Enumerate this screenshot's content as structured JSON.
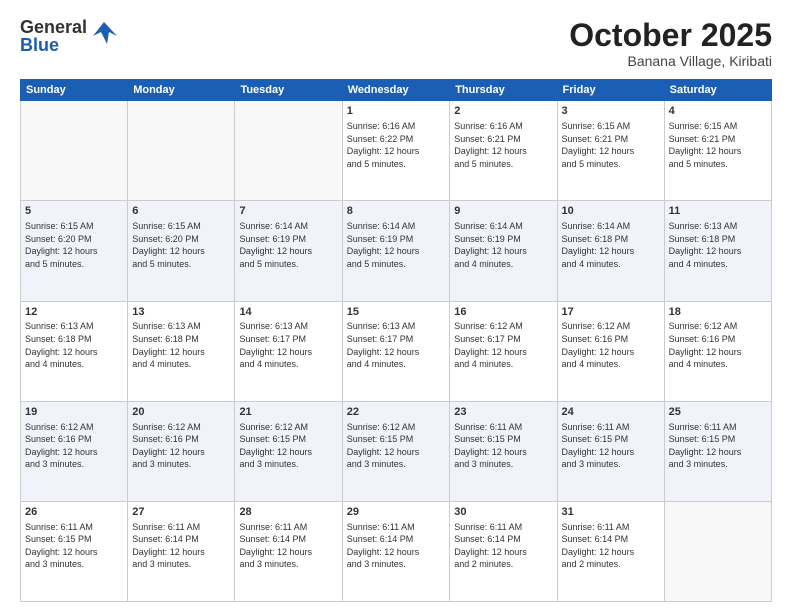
{
  "header": {
    "logo_general": "General",
    "logo_blue": "Blue",
    "month_title": "October 2025",
    "location": "Banana Village, Kiribati"
  },
  "days_of_week": [
    "Sunday",
    "Monday",
    "Tuesday",
    "Wednesday",
    "Thursday",
    "Friday",
    "Saturday"
  ],
  "weeks": [
    [
      {
        "day": "",
        "info": ""
      },
      {
        "day": "",
        "info": ""
      },
      {
        "day": "",
        "info": ""
      },
      {
        "day": "1",
        "info": "Sunrise: 6:16 AM\nSunset: 6:22 PM\nDaylight: 12 hours\nand 5 minutes."
      },
      {
        "day": "2",
        "info": "Sunrise: 6:16 AM\nSunset: 6:21 PM\nDaylight: 12 hours\nand 5 minutes."
      },
      {
        "day": "3",
        "info": "Sunrise: 6:15 AM\nSunset: 6:21 PM\nDaylight: 12 hours\nand 5 minutes."
      },
      {
        "day": "4",
        "info": "Sunrise: 6:15 AM\nSunset: 6:21 PM\nDaylight: 12 hours\nand 5 minutes."
      }
    ],
    [
      {
        "day": "5",
        "info": "Sunrise: 6:15 AM\nSunset: 6:20 PM\nDaylight: 12 hours\nand 5 minutes."
      },
      {
        "day": "6",
        "info": "Sunrise: 6:15 AM\nSunset: 6:20 PM\nDaylight: 12 hours\nand 5 minutes."
      },
      {
        "day": "7",
        "info": "Sunrise: 6:14 AM\nSunset: 6:19 PM\nDaylight: 12 hours\nand 5 minutes."
      },
      {
        "day": "8",
        "info": "Sunrise: 6:14 AM\nSunset: 6:19 PM\nDaylight: 12 hours\nand 5 minutes."
      },
      {
        "day": "9",
        "info": "Sunrise: 6:14 AM\nSunset: 6:19 PM\nDaylight: 12 hours\nand 4 minutes."
      },
      {
        "day": "10",
        "info": "Sunrise: 6:14 AM\nSunset: 6:18 PM\nDaylight: 12 hours\nand 4 minutes."
      },
      {
        "day": "11",
        "info": "Sunrise: 6:13 AM\nSunset: 6:18 PM\nDaylight: 12 hours\nand 4 minutes."
      }
    ],
    [
      {
        "day": "12",
        "info": "Sunrise: 6:13 AM\nSunset: 6:18 PM\nDaylight: 12 hours\nand 4 minutes."
      },
      {
        "day": "13",
        "info": "Sunrise: 6:13 AM\nSunset: 6:18 PM\nDaylight: 12 hours\nand 4 minutes."
      },
      {
        "day": "14",
        "info": "Sunrise: 6:13 AM\nSunset: 6:17 PM\nDaylight: 12 hours\nand 4 minutes."
      },
      {
        "day": "15",
        "info": "Sunrise: 6:13 AM\nSunset: 6:17 PM\nDaylight: 12 hours\nand 4 minutes."
      },
      {
        "day": "16",
        "info": "Sunrise: 6:12 AM\nSunset: 6:17 PM\nDaylight: 12 hours\nand 4 minutes."
      },
      {
        "day": "17",
        "info": "Sunrise: 6:12 AM\nSunset: 6:16 PM\nDaylight: 12 hours\nand 4 minutes."
      },
      {
        "day": "18",
        "info": "Sunrise: 6:12 AM\nSunset: 6:16 PM\nDaylight: 12 hours\nand 4 minutes."
      }
    ],
    [
      {
        "day": "19",
        "info": "Sunrise: 6:12 AM\nSunset: 6:16 PM\nDaylight: 12 hours\nand 3 minutes."
      },
      {
        "day": "20",
        "info": "Sunrise: 6:12 AM\nSunset: 6:16 PM\nDaylight: 12 hours\nand 3 minutes."
      },
      {
        "day": "21",
        "info": "Sunrise: 6:12 AM\nSunset: 6:15 PM\nDaylight: 12 hours\nand 3 minutes."
      },
      {
        "day": "22",
        "info": "Sunrise: 6:12 AM\nSunset: 6:15 PM\nDaylight: 12 hours\nand 3 minutes."
      },
      {
        "day": "23",
        "info": "Sunrise: 6:11 AM\nSunset: 6:15 PM\nDaylight: 12 hours\nand 3 minutes."
      },
      {
        "day": "24",
        "info": "Sunrise: 6:11 AM\nSunset: 6:15 PM\nDaylight: 12 hours\nand 3 minutes."
      },
      {
        "day": "25",
        "info": "Sunrise: 6:11 AM\nSunset: 6:15 PM\nDaylight: 12 hours\nand 3 minutes."
      }
    ],
    [
      {
        "day": "26",
        "info": "Sunrise: 6:11 AM\nSunset: 6:15 PM\nDaylight: 12 hours\nand 3 minutes."
      },
      {
        "day": "27",
        "info": "Sunrise: 6:11 AM\nSunset: 6:14 PM\nDaylight: 12 hours\nand 3 minutes."
      },
      {
        "day": "28",
        "info": "Sunrise: 6:11 AM\nSunset: 6:14 PM\nDaylight: 12 hours\nand 3 minutes."
      },
      {
        "day": "29",
        "info": "Sunrise: 6:11 AM\nSunset: 6:14 PM\nDaylight: 12 hours\nand 3 minutes."
      },
      {
        "day": "30",
        "info": "Sunrise: 6:11 AM\nSunset: 6:14 PM\nDaylight: 12 hours\nand 2 minutes."
      },
      {
        "day": "31",
        "info": "Sunrise: 6:11 AM\nSunset: 6:14 PM\nDaylight: 12 hours\nand 2 minutes."
      },
      {
        "day": "",
        "info": ""
      }
    ]
  ]
}
